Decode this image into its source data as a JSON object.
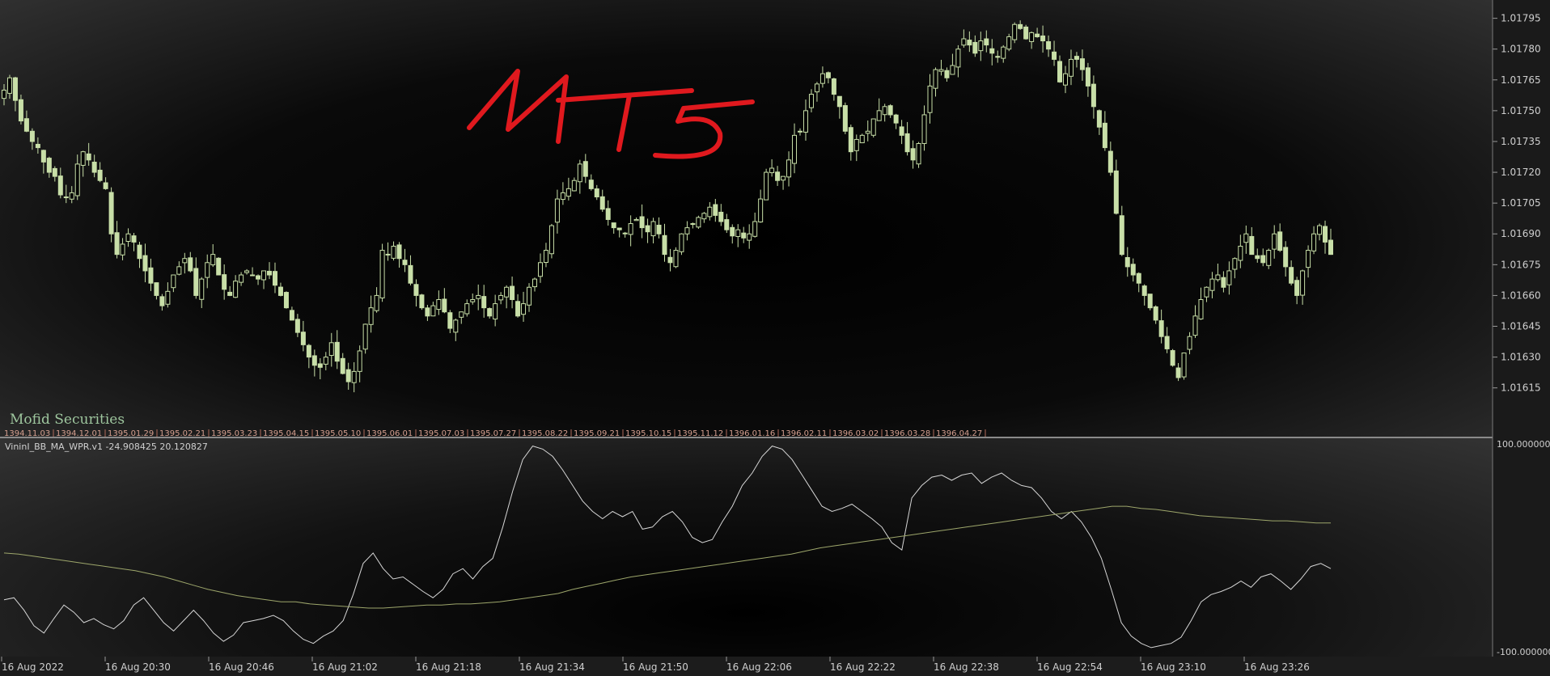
{
  "brand": "Mofid Securities",
  "annotation": "MT5",
  "indicator_label": "VininI_BB_MA_WPR.v1 -24.908425 20.120827",
  "colors": {
    "candle": "#c8dfa8",
    "wpr_line": "#d6d6d6",
    "ma_line": "#9da66b",
    "axis_text": "#cfcfcf",
    "annotation": "#e0191e",
    "date_labels": "#d6a090"
  },
  "chart_data": [
    {
      "type": "candlestick",
      "title": "",
      "ylim": [
        1.01607,
        1.01798
      ],
      "y_ticks": [
        "1.01795",
        "1.01780",
        "1.01765",
        "1.01750",
        "1.01735",
        "1.01720",
        "1.01705",
        "1.01690",
        "1.01675",
        "1.01660",
        "1.01645",
        "1.01630",
        "1.01615"
      ],
      "x_ticks": [
        "16 Aug 2022",
        "16 Aug 20:30",
        "16 Aug 20:46",
        "16 Aug 21:02",
        "16 Aug 21:18",
        "16 Aug 21:34",
        "16 Aug 21:50",
        "16 Aug 22:06",
        "16 Aug 22:22",
        "16 Aug 22:38",
        "16 Aug 22:54",
        "16 Aug 23:10",
        "16 Aug 23:26"
      ],
      "overlay_dates": [
        "1394.11.03",
        "1394.12.01",
        "1395.01.29",
        "1395.02.21",
        "1395.03.23",
        "1395.04.15",
        "1395.05.10",
        "1395.06.01",
        "1395.07.03",
        "1395.07.27",
        "1395.08.22",
        "1395.09.21",
        "1395.10.15",
        "1395.11.12",
        "1396.01.16",
        "1396.02.11",
        "1396.03.02",
        "1396.03.28",
        "1396.04.27"
      ],
      "close": [
        1.0176,
        1.01766,
        1.01755,
        1.01745,
        1.0174,
        1.01735,
        1.01732,
        1.01725,
        1.0172,
        1.01718,
        1.01709,
        1.01708,
        1.0171,
        1.01724,
        1.0173,
        1.01726,
        1.0172,
        1.01716,
        1.01712,
        1.0169,
        1.0168,
        1.01685,
        1.0169,
        1.01686,
        1.01678,
        1.01672,
        1.01666,
        1.0166,
        1.01655,
        1.01662,
        1.0167,
        1.01674,
        1.01678,
        1.01672,
        1.0166,
        1.01668,
        1.01676,
        1.0168,
        1.0167,
        1.01663,
        1.0166,
        1.01667,
        1.0167,
        1.01672,
        1.0167,
        1.01668,
        1.01672,
        1.0167,
        1.01665,
        1.0166,
        1.01654,
        1.01648,
        1.01642,
        1.01636,
        1.0163,
        1.01626,
        1.01625,
        1.0163,
        1.01637,
        1.01628,
        1.01622,
        1.01618,
        1.01623,
        1.01633,
        1.01646,
        1.01654,
        1.0166,
        1.01682,
        1.0168,
        1.01684,
        1.01678,
        1.01675,
        1.01666,
        1.0166,
        1.01654,
        1.0165,
        1.01655,
        1.01658,
        1.01652,
        1.01644,
        1.01648,
        1.01652,
        1.01656,
        1.01658,
        1.0166,
        1.01654,
        1.0165,
        1.01656,
        1.0166,
        1.01664,
        1.01658,
        1.0165,
        1.01656,
        1.01664,
        1.01668,
        1.01676,
        1.01682,
        1.01694,
        1.01707,
        1.0171,
        1.01712,
        1.01716,
        1.01724,
        1.01718,
        1.01712,
        1.01708,
        1.01702,
        1.01697,
        1.01693,
        1.01692,
        1.0169,
        1.01695,
        1.01697,
        1.01693,
        1.01691,
        1.01696,
        1.0169,
        1.0168,
        1.01676,
        1.01682,
        1.0169,
        1.01693,
        1.01695,
        1.01698,
        1.017,
        1.01703,
        1.01699,
        1.01696,
        1.01692,
        1.01689,
        1.01692,
        1.01688,
        1.0169,
        1.01696,
        1.01707,
        1.0172,
        1.01722,
        1.01716,
        1.01718,
        1.01726,
        1.01738,
        1.0174,
        1.0175,
        1.01758,
        1.01763,
        1.01768,
        1.01766,
        1.01758,
        1.01752,
        1.0174,
        1.0173,
        1.01736,
        1.01738,
        1.0174,
        1.01746,
        1.0175,
        1.01752,
        1.01748,
        1.01744,
        1.01738,
        1.0173,
        1.01726,
        1.01734,
        1.01748,
        1.01762,
        1.0177,
        1.0177,
        1.01766,
        1.01772,
        1.0178,
        1.01785,
        1.01782,
        1.01778,
        1.01784,
        1.01782,
        1.01778,
        1.01776,
        1.01781,
        1.01786,
        1.01792,
        1.0179,
        1.01785,
        1.01788,
        1.01786,
        1.01784,
        1.0178,
        1.01775,
        1.01764,
        1.01768,
        1.01775,
        1.01775,
        1.0177,
        1.01762,
        1.01752,
        1.01742,
        1.01732,
        1.0172,
        1.017,
        1.0168,
        1.01674,
        1.0167,
        1.01666,
        1.0166,
        1.01654,
        1.01648,
        1.0164,
        1.01634,
        1.01626,
        1.0162,
        1.01632,
        1.0164,
        1.0165,
        1.01658,
        1.01664,
        1.01668,
        1.0167,
        1.01664,
        1.01672,
        1.01678,
        1.01684,
        1.0169,
        1.0168,
        1.01678,
        1.01676,
        1.01682,
        1.0169,
        1.01682,
        1.01674,
        1.01666,
        1.0166,
        1.01672,
        1.01682,
        1.0169,
        1.01694,
        1.01686,
        1.0168
      ]
    },
    {
      "type": "line",
      "title": "VininI_BB_MA_WPR.v1",
      "ylim": [
        -100,
        100
      ],
      "y_ticks": [
        "100.000000",
        "-100.000000"
      ],
      "series": [
        {
          "role": "wpr",
          "values": [
            -50,
            -48,
            -60,
            -75,
            -82,
            -68,
            -55,
            -62,
            -72,
            -68,
            -74,
            -78,
            -70,
            -55,
            -48,
            -60,
            -72,
            -80,
            -70,
            -60,
            -70,
            -82,
            -90,
            -84,
            -72,
            -70,
            -68,
            -65,
            -70,
            -80,
            -88,
            -92,
            -85,
            -80,
            -70,
            -45,
            -15,
            -5,
            -20,
            -30,
            -28,
            -35,
            -42,
            -48,
            -40,
            -25,
            -20,
            -30,
            -18,
            -10,
            20,
            55,
            85,
            98,
            95,
            88,
            75,
            60,
            45,
            35,
            28,
            35,
            30,
            35,
            18,
            20,
            30,
            35,
            25,
            10,
            5,
            8,
            25,
            40,
            60,
            72,
            88,
            98,
            95,
            85,
            70,
            55,
            40,
            35,
            38,
            42,
            35,
            28,
            20,
            5,
            -2,
            48,
            60,
            68,
            70,
            65,
            70,
            72,
            62,
            68,
            72,
            65,
            60,
            58,
            48,
            35,
            28,
            35,
            25,
            10,
            -10,
            -40,
            -72,
            -85,
            -92,
            -96,
            -94,
            -92,
            -86,
            -70,
            -52,
            -45,
            -42,
            -38,
            -32,
            -38,
            -28,
            -25,
            -32,
            -40,
            -30,
            -18,
            -15,
            -20
          ]
        },
        {
          "role": "ma",
          "values": [
            -5,
            -6,
            -8,
            -10,
            -12,
            -14,
            -16,
            -18,
            -20,
            -22,
            -25,
            -28,
            -32,
            -36,
            -40,
            -43,
            -46,
            -48,
            -50,
            -52,
            -52,
            -54,
            -55,
            -56,
            -57,
            -58,
            -58,
            -57,
            -56,
            -55,
            -55,
            -54,
            -54,
            -53,
            -52,
            -50,
            -48,
            -46,
            -44,
            -40,
            -37,
            -34,
            -31,
            -28,
            -26,
            -24,
            -22,
            -20,
            -18,
            -16,
            -14,
            -12,
            -10,
            -8,
            -6,
            -3,
            0,
            2,
            4,
            6,
            8,
            10,
            12,
            14,
            16,
            18,
            20,
            22,
            24,
            26,
            28,
            30,
            32,
            34,
            36,
            38,
            40,
            40,
            38,
            37,
            35,
            33,
            31,
            30,
            29,
            28,
            27,
            26,
            26,
            25,
            24,
            24
          ]
        }
      ]
    }
  ]
}
